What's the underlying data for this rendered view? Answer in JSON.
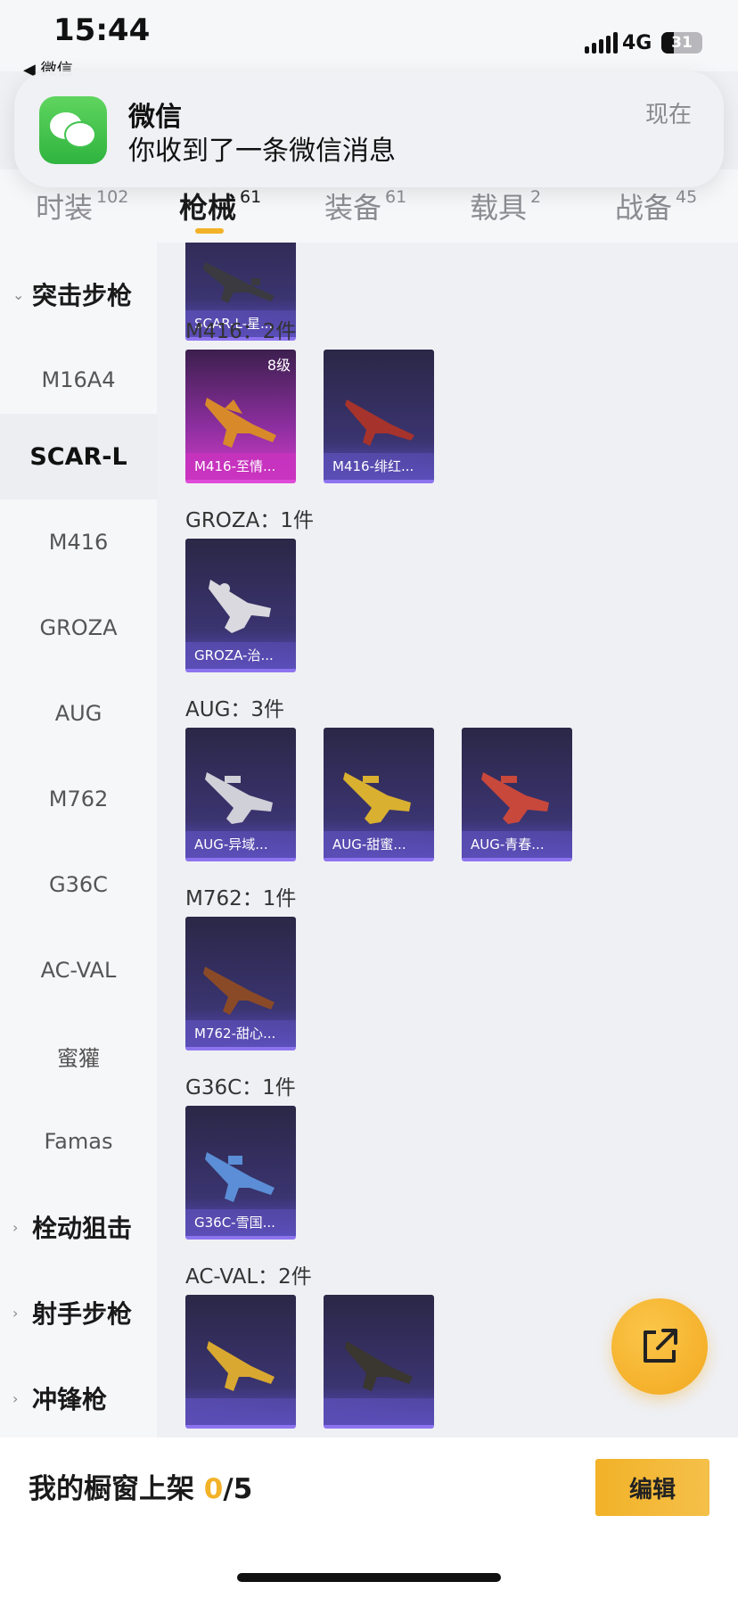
{
  "status_bar": {
    "time": "15:44",
    "back_label": "◀ 微信",
    "network": "4G",
    "battery": "31",
    "battery_level": 0.31
  },
  "notification": {
    "app": "微信",
    "message": "你收到了一条微信消息",
    "time": "现在",
    "icon": "wechat-icon"
  },
  "tabs": [
    {
      "label": "时装",
      "count": "102"
    },
    {
      "label": "枪械",
      "count": "61",
      "active": true
    },
    {
      "label": "装备",
      "count": "61"
    },
    {
      "label": "载具",
      "count": "2"
    },
    {
      "label": "战备",
      "count": "45"
    }
  ],
  "sidebar": {
    "categories": [
      {
        "label": "突击步枪",
        "expanded": true
      },
      {
        "label": "栓动狙击",
        "expanded": false
      },
      {
        "label": "射手步枪",
        "expanded": false
      },
      {
        "label": "冲锋枪",
        "expanded": false
      }
    ],
    "items": [
      "M16A4",
      "SCAR-L",
      "M416",
      "GROZA",
      "AUG",
      "M762",
      "G36C",
      "AC-VAL",
      "蜜獾",
      "Famas"
    ],
    "active_item": "SCAR-L"
  },
  "sections": [
    {
      "title": "",
      "items": [
        {
          "name": "SCAR-L-星..."
        }
      ]
    },
    {
      "title": "M416：2件",
      "items": [
        {
          "name": "M416-至情...",
          "level": "8级",
          "rarity": "pink"
        },
        {
          "name": "M416-绯红..."
        }
      ]
    },
    {
      "title": "GROZA：1件",
      "items": [
        {
          "name": "GROZA-治..."
        }
      ]
    },
    {
      "title": "AUG：3件",
      "items": [
        {
          "name": "AUG-异域..."
        },
        {
          "name": "AUG-甜蜜..."
        },
        {
          "name": "AUG-青春..."
        }
      ]
    },
    {
      "title": "M762：1件",
      "items": [
        {
          "name": "M762-甜心..."
        }
      ]
    },
    {
      "title": "G36C：1件",
      "items": [
        {
          "name": "G36C-雪国..."
        }
      ]
    },
    {
      "title": "AC-VAL：2件",
      "items": [
        {
          "name": ""
        },
        {
          "name": ""
        }
      ]
    }
  ],
  "gun_colors": [
    "#3a3a40",
    "#d8892a",
    "#a6332c",
    "#d9d9df",
    "#d0d0d8",
    "#d9b030",
    "#c8483c",
    "#8a4a28",
    "#5b8ed6",
    "#d9a830",
    "#3a3630"
  ],
  "fab": {
    "icon": "share-icon"
  },
  "bottom_bar": {
    "label": "我的橱窗上架 ",
    "count_used": "0",
    "count_total": "/5",
    "edit_label": "编辑"
  }
}
